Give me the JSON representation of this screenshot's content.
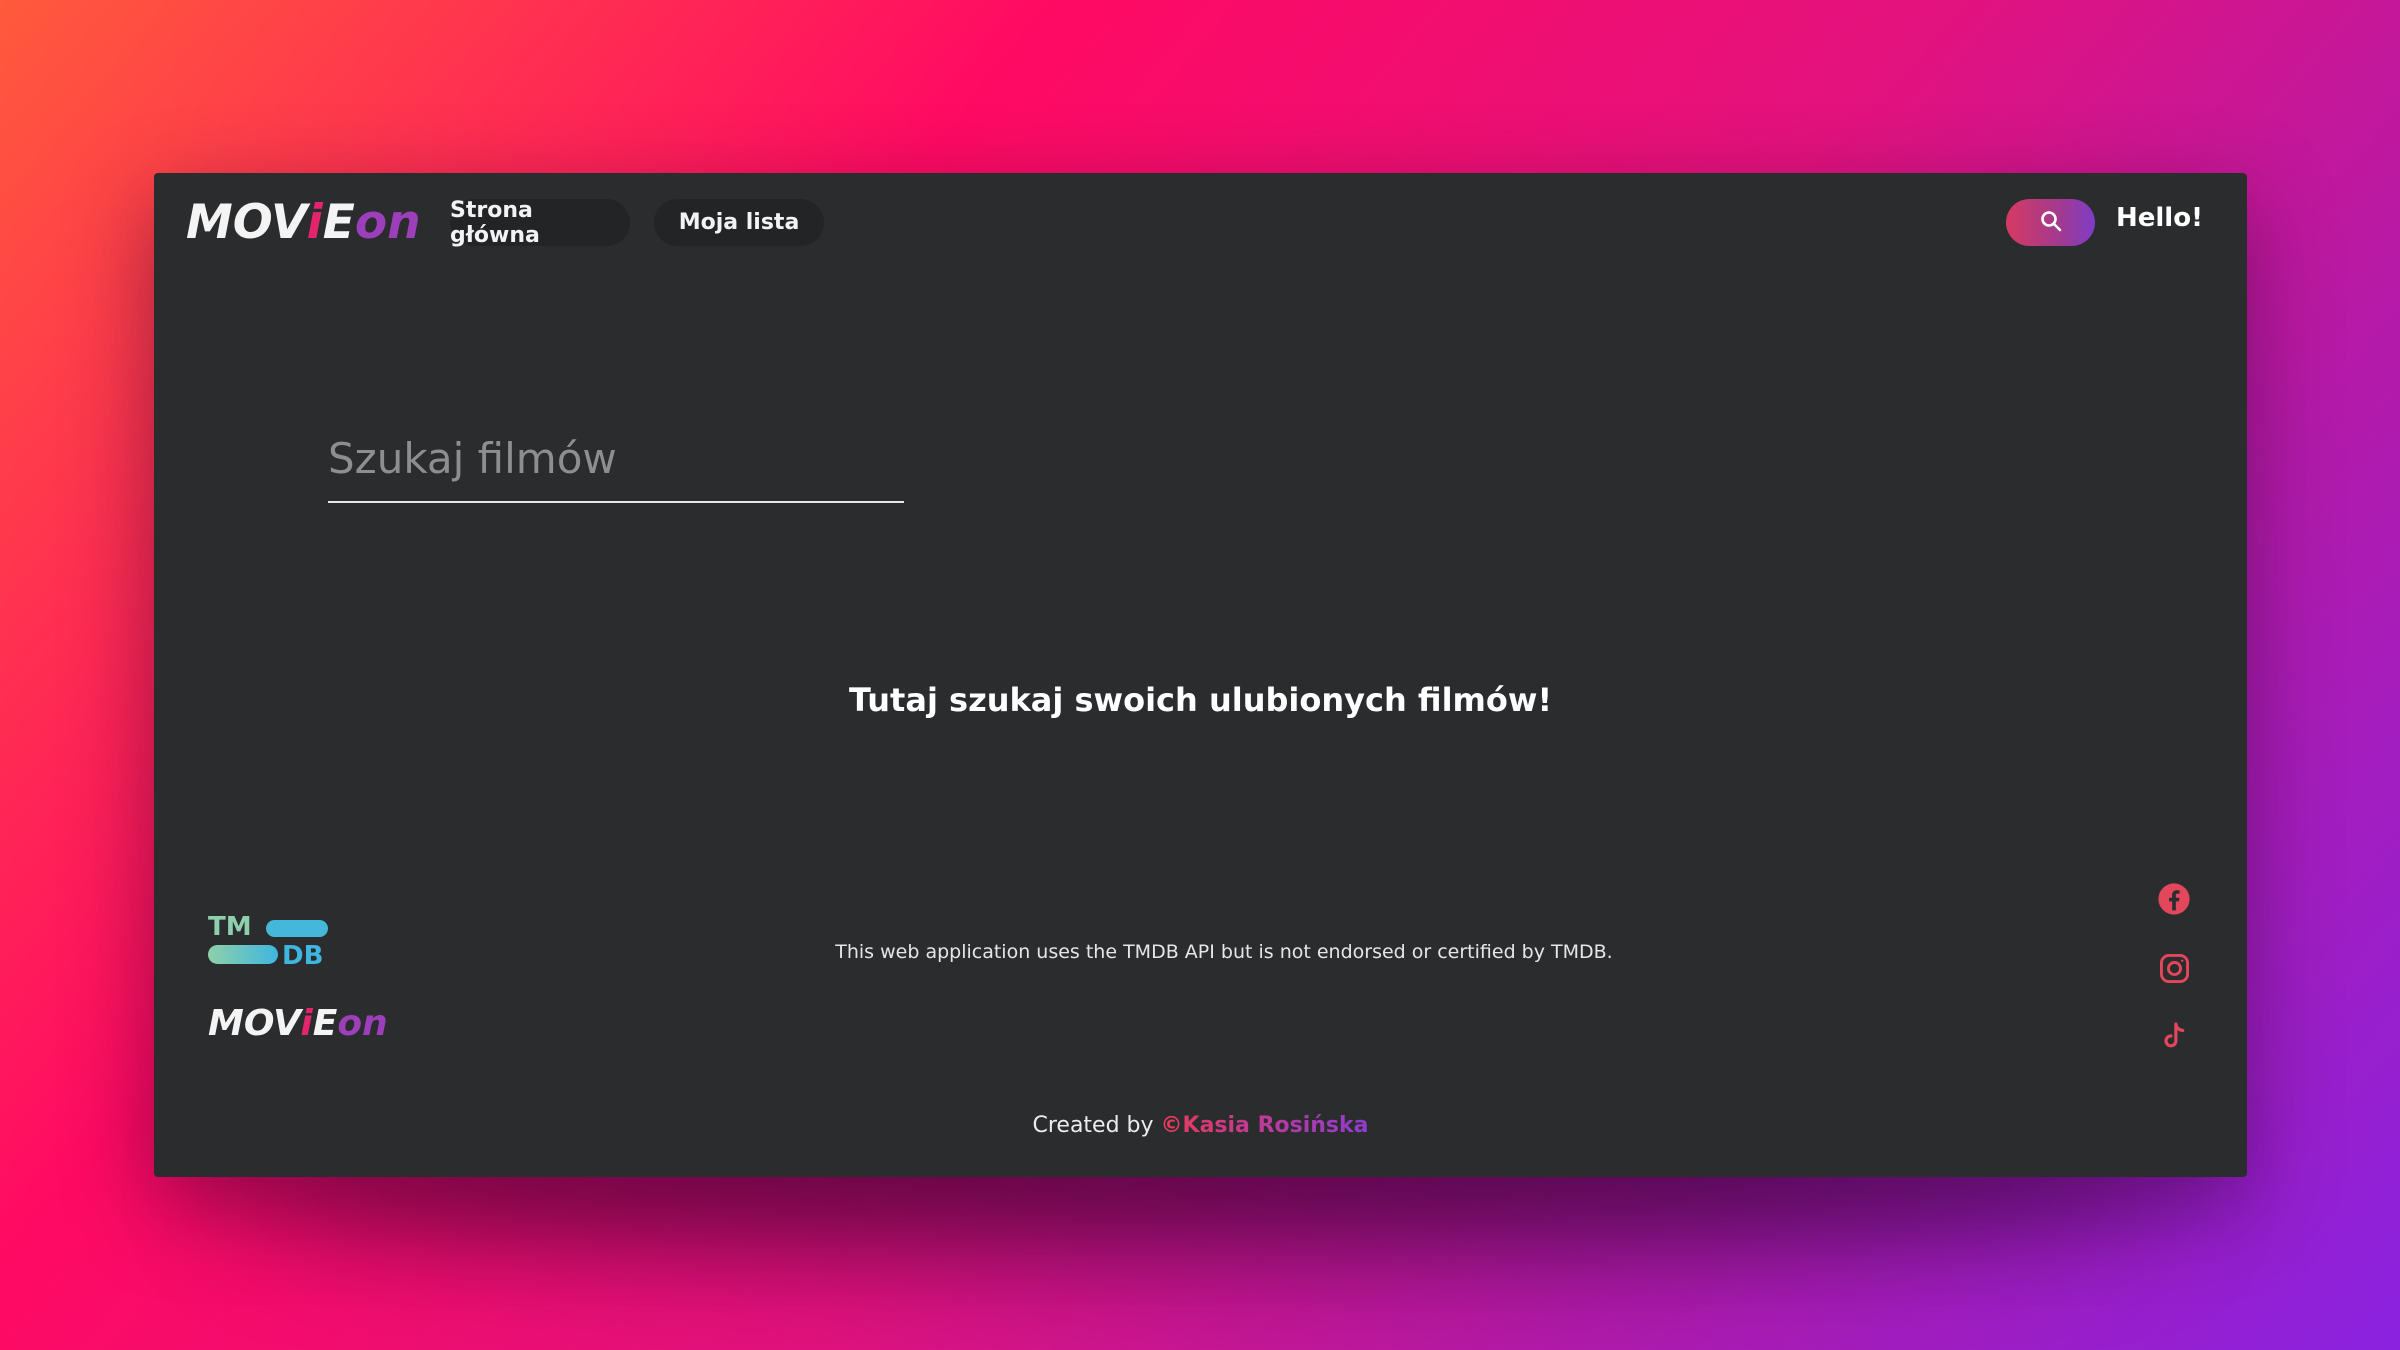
{
  "brand": {
    "logo_parts": [
      "MOV",
      "i",
      "E",
      "on"
    ],
    "colors": {
      "white": "#f4f4f4",
      "pink": "#e4246d",
      "purple": "#9d3fba"
    }
  },
  "nav": {
    "home_label": "Strona główna",
    "mylist_label": "Moja lista"
  },
  "header": {
    "search_icon": "search-icon",
    "greeting": "Hello!"
  },
  "search": {
    "placeholder": "Szukaj filmów",
    "value": ""
  },
  "main": {
    "tagline": "Tutaj szukaj swoich ulubionych filmów!"
  },
  "footer": {
    "tmdb_logo_letters": [
      "TM",
      "DB"
    ],
    "disclaimer": "This web application uses the TMDB API but is not endorsed or certified by TMDB.",
    "social_icons": [
      "facebook-icon",
      "instagram-icon",
      "tiktok-icon"
    ],
    "social_color": "#e3475b",
    "credits_prefix": "Created by ",
    "author": "©Kasia Rosińska"
  }
}
